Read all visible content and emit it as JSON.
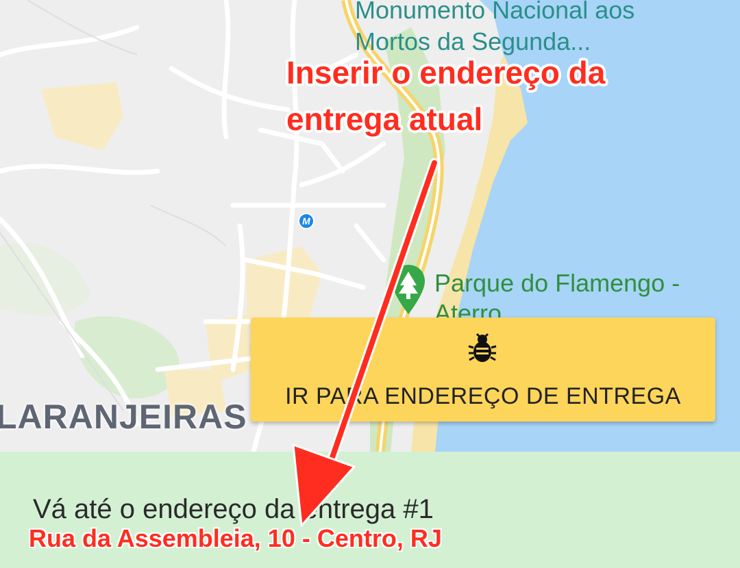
{
  "map": {
    "poi_monument": "Monumento Nacional aos Mortos da Segunda...",
    "poi_park": "Parque do Flamengo - Aterro",
    "district": "LARANJEIRAS",
    "metro_symbol": "M",
    "colors": {
      "water": "#a8d4f7",
      "land": "#eeeeee",
      "park": "#cfe8c2",
      "sand": "#f7e4a8",
      "road": "#ffffff",
      "highway": "#f6d46b"
    }
  },
  "annotation": {
    "text": "Inserir o endereço da entrega atual",
    "color": "#ff2d1f"
  },
  "action_card": {
    "icon": "bug-icon",
    "label": "IR PARA ENDEREÇO DE ENTREGA",
    "color": "#fdd55a"
  },
  "bottom_panel": {
    "instruction": "Vá até o endereço da entrega #1",
    "address": "Rua da Assembleia, 10 - Centro, RJ",
    "color": "#d3f0d3"
  }
}
